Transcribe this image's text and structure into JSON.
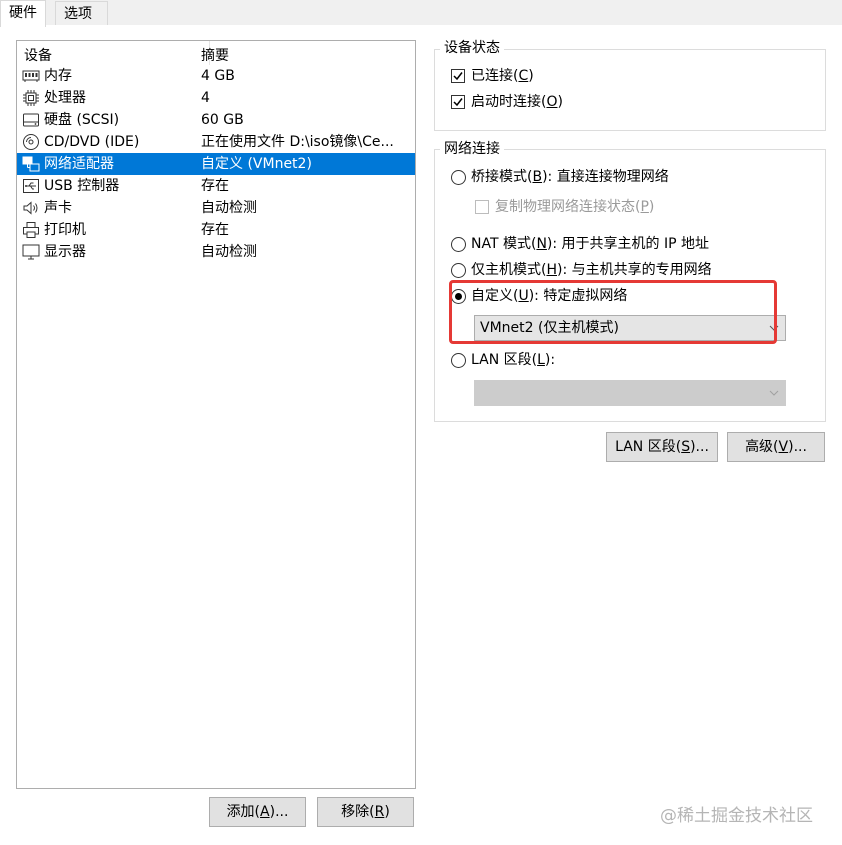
{
  "tabs": [
    {
      "label": "硬件",
      "active": true
    },
    {
      "label": "选项",
      "active": false
    }
  ],
  "device_list": {
    "columns": [
      "设备",
      "摘要"
    ],
    "rows": [
      {
        "icon": "memory-icon",
        "device": "内存",
        "summary": "4 GB",
        "selected": false
      },
      {
        "icon": "processor-icon",
        "device": "处理器",
        "summary": "4",
        "selected": false
      },
      {
        "icon": "hard-disk-icon",
        "device": "硬盘 (SCSI)",
        "summary": "60 GB",
        "selected": false
      },
      {
        "icon": "cd-dvd-icon",
        "device": "CD/DVD (IDE)",
        "summary": "正在使用文件 D:\\iso镜像\\Ce...",
        "selected": false
      },
      {
        "icon": "network-adapter-icon",
        "device": "网络适配器",
        "summary": "自定义 (VMnet2)",
        "selected": true
      },
      {
        "icon": "usb-icon",
        "device": "USB 控制器",
        "summary": "存在",
        "selected": false
      },
      {
        "icon": "sound-card-icon",
        "device": "声卡",
        "summary": "自动检测",
        "selected": false
      },
      {
        "icon": "printer-icon",
        "device": "打印机",
        "summary": "存在",
        "selected": false
      },
      {
        "icon": "display-icon",
        "device": "显示器",
        "summary": "自动检测",
        "selected": false
      }
    ]
  },
  "list_buttons": {
    "add": {
      "text": "添加(",
      "key": "A",
      "suffix": ")..."
    },
    "remove": {
      "text": "移除(",
      "key": "R",
      "suffix": ")"
    }
  },
  "device_status": {
    "title": "设备状态",
    "connected": {
      "text": "已连接(",
      "key": "C",
      "suffix": ")",
      "checked": true
    },
    "connect_at_power_on": {
      "text": "启动时连接(",
      "key": "O",
      "suffix": ")",
      "checked": true
    }
  },
  "network_connection": {
    "title": "网络连接",
    "bridged": {
      "text": "桥接模式(",
      "key": "B",
      "suffix": "): 直接连接物理网络",
      "selected": false
    },
    "replicate": {
      "text": "复制物理网络连接状态(",
      "key": "P",
      "suffix": ")",
      "checked": false,
      "disabled": true
    },
    "nat": {
      "text": "NAT 模式(",
      "key": "N",
      "suffix": "): 用于共享主机的 IP 地址",
      "selected": false
    },
    "host_only": {
      "text": "仅主机模式(",
      "key": "H",
      "suffix": "): 与主机共享的专用网络",
      "selected": false
    },
    "custom": {
      "text": "自定义(",
      "key": "U",
      "suffix": "): 特定虚拟网络",
      "selected": true
    },
    "custom_value": "VMnet2 (仅主机模式)",
    "lan_segment": {
      "text": "LAN 区段(",
      "key": "L",
      "suffix": "):",
      "selected": false
    },
    "lan_segment_value": ""
  },
  "bottom_buttons": {
    "lan_segments": {
      "text": "LAN 区段(",
      "key": "S",
      "suffix": ")..."
    },
    "advanced": {
      "text": "高级(",
      "key": "V",
      "suffix": ")..."
    }
  },
  "colors": {
    "selection": "#0078d7",
    "highlight_box": "#e53935"
  },
  "watermark": "@稀土掘金技术社区"
}
